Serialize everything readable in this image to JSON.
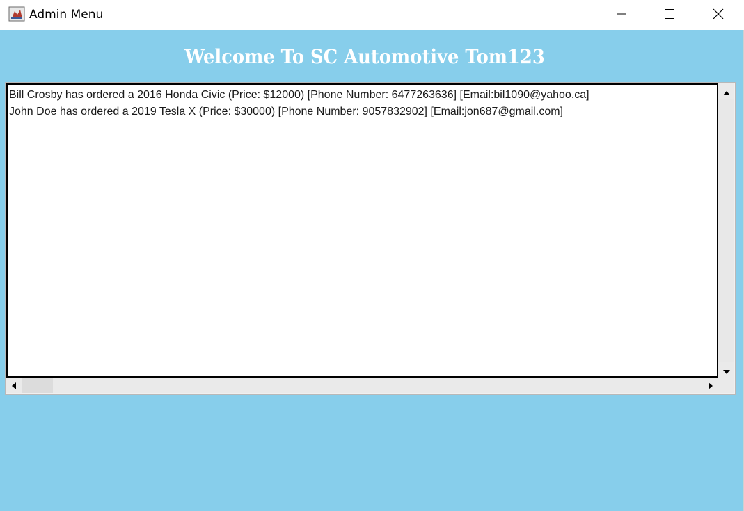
{
  "window": {
    "title": "Admin Menu",
    "app_icon": "java-app-icon",
    "controls": {
      "minimize": "minimize-icon",
      "maximize": "maximize-icon",
      "close": "close-icon"
    }
  },
  "header": {
    "welcome_text": "Welcome To SC Automotive Tom123"
  },
  "orders": [
    "Bill Crosby has ordered a 2016 Honda Civic (Price: $12000) [Phone Number: 6477263636] [Email:bil1090@yahoo.ca]",
    "John Doe has ordered a 2019 Tesla X (Price: $30000) [Phone Number: 9057832902] [Email:jon687@gmail.com]"
  ],
  "colors": {
    "background": "#87ceeb",
    "welcome_text": "#ffffff"
  }
}
